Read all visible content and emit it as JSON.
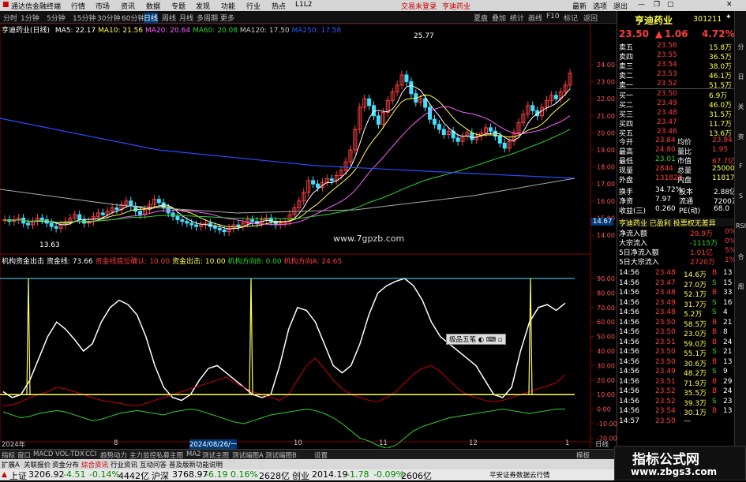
{
  "titlebar": {
    "app": "通达信金融终端",
    "menus": [
      "行情",
      "市场",
      "资讯",
      "数据",
      "专题",
      "发现",
      "功能",
      "行业",
      "热点",
      "L1L2"
    ],
    "trade": "交易未登录",
    "stock": "亨迪药业",
    "controls": [
      "夏盘",
      "叠加",
      "统计",
      "画线",
      "F10",
      "标记",
      "返回"
    ],
    "right": [
      "最新",
      "选项",
      "退出"
    ]
  },
  "periods": [
    "分时",
    "1分钟",
    "5分钟",
    "15分钟",
    "30分钟",
    "60分钟",
    "日线",
    "周线",
    "月线",
    "多周期",
    "更多"
  ],
  "active_period": "日线",
  "ma_legend": {
    "name": "亨迪药业(日线)",
    "ma5": "MA5: 22.17",
    "ma10": "MA10: 21.56",
    "ma20": "MA20: 20.64",
    "ma60": "MA60: 20.08",
    "ma120": "MA120: 17.50",
    "ma250": "MA250: 17.58"
  },
  "annotations": {
    "high": "25.77",
    "low": "13.63",
    "site": "www.7gpzb.com",
    "last_price": "14.67"
  },
  "price_ticks": [
    "24.00",
    "23.00",
    "22.00",
    "21.00",
    "20.00",
    "19.00",
    "18.00",
    "17.00",
    "16.00",
    "15.00",
    "14.00"
  ],
  "ind_legend": {
    "name": "机构资金出击",
    "l1": "资金线: 73.66",
    "l2": "资金线底位确认: 10.00",
    "l3": "资金出击: 10.00",
    "l4": "机构方向B: 0.00",
    "l5": "机构方向A: 24.65"
  },
  "ind_ticks": [
    "90.00",
    "80.00",
    "70.00",
    "60.00",
    "50.00",
    "40.00",
    "30.00",
    "20.00",
    "10.00",
    "0.00",
    "-10.00",
    "-20.00"
  ],
  "popup": "极品五笔",
  "dates": [
    "2024年",
    "8",
    "2024/08/26/一",
    "10",
    "11",
    "12",
    "1",
    "日线"
  ],
  "quote": {
    "name": "亨迪药业",
    "code": "301211",
    "price": "23.50",
    "change": "1.06",
    "pct": "4.72%",
    "asks": [
      {
        "l": "卖五",
        "p": "23.56",
        "v": "15.8万"
      },
      {
        "l": "卖四",
        "p": "23.55",
        "v": "36.5万"
      },
      {
        "l": "卖三",
        "p": "23.54",
        "v": "38.0万"
      },
      {
        "l": "卖二",
        "p": "23.53",
        "v": "46.1万"
      },
      {
        "l": "卖一",
        "p": "23.52",
        "v": "51.5万"
      }
    ],
    "bids": [
      {
        "l": "买一",
        "p": "23.50",
        "v": "6.9万"
      },
      {
        "l": "买二",
        "p": "23.49",
        "v": "46.0万"
      },
      {
        "l": "买三",
        "p": "23.48",
        "v": "31.5万"
      },
      {
        "l": "买四",
        "p": "23.47",
        "v": "11.7万"
      },
      {
        "l": "买五",
        "p": "23.46",
        "v": "13.6万"
      }
    ],
    "stats": [
      {
        "a": "今开",
        "b": "23.84",
        "c": "均价",
        "d": "23.94"
      },
      {
        "a": "最高",
        "b": "24.80",
        "c": "量比",
        "d": "1.95"
      },
      {
        "a": "最低",
        "b": "23.01",
        "c": "市值",
        "d": "67.7亿"
      },
      {
        "a": "现量",
        "b": "2844",
        "c": "总量",
        "d": "250006"
      },
      {
        "a": "外盘",
        "b": "131828",
        "c": "内盘",
        "d": "118178"
      }
    ],
    "stats2": [
      {
        "a": "换手",
        "b": "34.72%",
        "c": "股本",
        "d": "2.88亿"
      },
      {
        "a": "净资",
        "b": "7.97",
        "c": "流通",
        "d": "7200万"
      },
      {
        "a": "收益(三)",
        "b": "0.260",
        "c": "PE(动)",
        "d": "68.0"
      }
    ],
    "tag": "亨迪药业 已盈利 投票权无差异",
    "flows": [
      {
        "l": "净流入额",
        "v": "29.9万",
        "p": "0%"
      },
      {
        "l": "大宗流入",
        "v": "-1115万",
        "p": "0%"
      },
      {
        "l": "5日净流入额",
        "v": "1.01亿",
        "p": "5%"
      },
      {
        "l": "5日大宗流入",
        "v": "2720万",
        "p": "1%"
      }
    ],
    "ticks": [
      {
        "t": "14:56",
        "p": "23.48",
        "v": "14.6万",
        "s": "B",
        "n": "13"
      },
      {
        "t": "14:56",
        "p": "23.47",
        "v": "27.0万",
        "s": "S",
        "n": "15"
      },
      {
        "t": "14:56",
        "p": "23.48",
        "v": "52.1万",
        "s": "B",
        "n": "33"
      },
      {
        "t": "14:56",
        "p": "23.49",
        "v": "31.7万",
        "s": "S",
        "n": "16"
      },
      {
        "t": "14:56",
        "p": "23.48",
        "v": "5.2万",
        "s": "S",
        "n": "4"
      },
      {
        "t": "14:56",
        "p": "23.50",
        "v": "58.5万",
        "s": "B",
        "n": "21"
      },
      {
        "t": "14:56",
        "p": "23.50",
        "v": "23.0万",
        "s": "B",
        "n": "8"
      },
      {
        "t": "14:56",
        "p": "23.51",
        "v": "59.0万",
        "s": "B",
        "n": "24"
      },
      {
        "t": "14:56",
        "p": "23.50",
        "v": "55.1万",
        "s": "S",
        "n": "21"
      },
      {
        "t": "14:56",
        "p": "23.50",
        "v": "30.6万",
        "s": "B",
        "n": "13"
      },
      {
        "t": "14:56",
        "p": "23.49",
        "v": "48.2万",
        "s": "S",
        "n": "9"
      },
      {
        "t": "14:56",
        "p": "23.51",
        "v": "71.9万",
        "s": "B",
        "n": "29"
      },
      {
        "t": "14:56",
        "p": "23.52",
        "v": "35.5万",
        "s": "B",
        "n": "24"
      },
      {
        "t": "14:56",
        "p": "23.52",
        "v": "39.3万",
        "s": "S",
        "n": "23"
      },
      {
        "t": "14:56",
        "p": "23.54",
        "v": "30.1万",
        "s": "B",
        "n": "13"
      },
      {
        "t": "14:57",
        "p": "23.50",
        "v": "—",
        "s": "",
        "n": ""
      }
    ]
  },
  "bottomtabs": [
    "指标",
    "窗口",
    "MACD",
    "VOL-TDX",
    "CCI",
    "趋势动力",
    "主力监控",
    "私募主图",
    "MA2",
    "测试主图",
    "测试幅图A",
    "测试幅图B",
    "设置"
  ],
  "bottomtab_right": "模板",
  "infobar": {
    "a": "扩展A",
    "b": "关联报价",
    "c": "资金分布",
    "d": "综合资讯",
    "e": "行业资讯",
    "f": "互动问答",
    "g": "普及版新功能说明"
  },
  "statusbar": {
    "sh": "上证",
    "sh_v": "3206.92",
    "sh_c": "-4.51",
    "sh_p": "-0.14%",
    "sh_a": "4442亿",
    "sz": "沪深",
    "sz_v": "3768.97",
    "sz_c": "-6.19",
    "sz_p": "0.16%",
    "sz_a": "2628亿",
    "cy": "创业",
    "cy_v": "2014.19",
    "cy_c": "-1.78",
    "cy_p": "-0.09%",
    "cy_a": "2606亿",
    "broker": "平安证券数据云行情"
  },
  "watermark": {
    "t1": "指标公式网",
    "t2": "www.zbgs3.com"
  },
  "sidebar": [
    "分",
    "日",
    "关",
    "资",
    "F",
    "S",
    "RSI",
    "合",
    "周"
  ]
}
